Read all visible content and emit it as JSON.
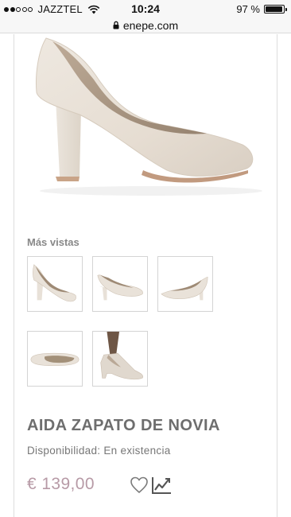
{
  "status_bar": {
    "carrier": "JAZZTEL",
    "time": "10:24",
    "battery": "97 %",
    "battery_level": 0.97,
    "signal_bars_filled": 2,
    "signal_bars_total": 5
  },
  "browser": {
    "url": "enepe.com"
  },
  "gallery": {
    "more_views_label": "Más vistas",
    "thumbnails": [
      {
        "icon": "shoe-side-view-thumbnail"
      },
      {
        "icon": "shoe-front-angle-thumbnail"
      },
      {
        "icon": "shoe-back-angle-thumbnail"
      },
      {
        "icon": "shoe-top-view-thumbnail"
      },
      {
        "icon": "shoe-worn-thumbnail"
      }
    ]
  },
  "product": {
    "title": "AIDA ZAPATO DE NOVIA",
    "availability": "Disponibilidad: En existencia",
    "price": "€ 139,00"
  },
  "actions": {
    "wishlist_icon": "heart-icon",
    "compare_icon": "chart-icon"
  },
  "colors": {
    "price": "#b79aa6",
    "title": "#6e6e6e",
    "shoe": "#ebe4db"
  }
}
